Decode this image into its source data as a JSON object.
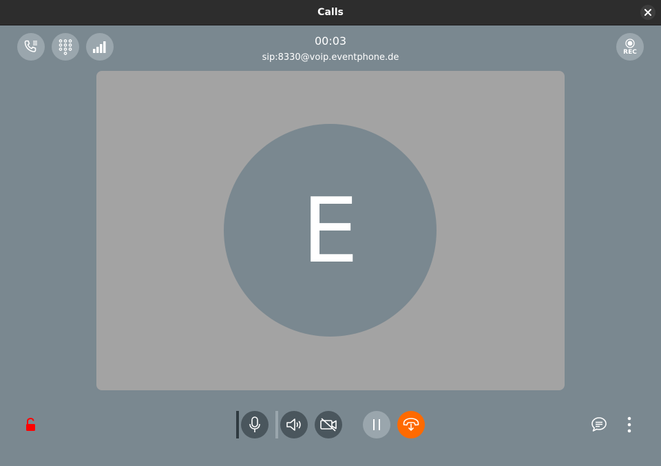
{
  "window": {
    "title": "Calls"
  },
  "call": {
    "duration": "00:03",
    "address": "sip:8330@voip.eventphone.de",
    "avatar_initial": "E"
  },
  "top_controls": {
    "icons": [
      "phone-list-icon",
      "dialpad-icon",
      "signal-strength-icon"
    ],
    "record_label": "REC"
  },
  "bottom_controls": {
    "security_icon": "unlocked-icon",
    "icons": [
      "microphone-icon",
      "speaker-icon",
      "camera-off-icon",
      "pause-icon",
      "hangup-icon"
    ],
    "right_icons": [
      "chat-icon",
      "more-vertical-icon"
    ]
  },
  "colors": {
    "background": "#7a8890",
    "titlebar": "#2d2d2d",
    "video_area": "#a3a3a3",
    "dark_button": "#4a565d",
    "light_button": "#9aa6ad",
    "hangup": "#ff6a00",
    "unlocked": "#ff0000"
  }
}
